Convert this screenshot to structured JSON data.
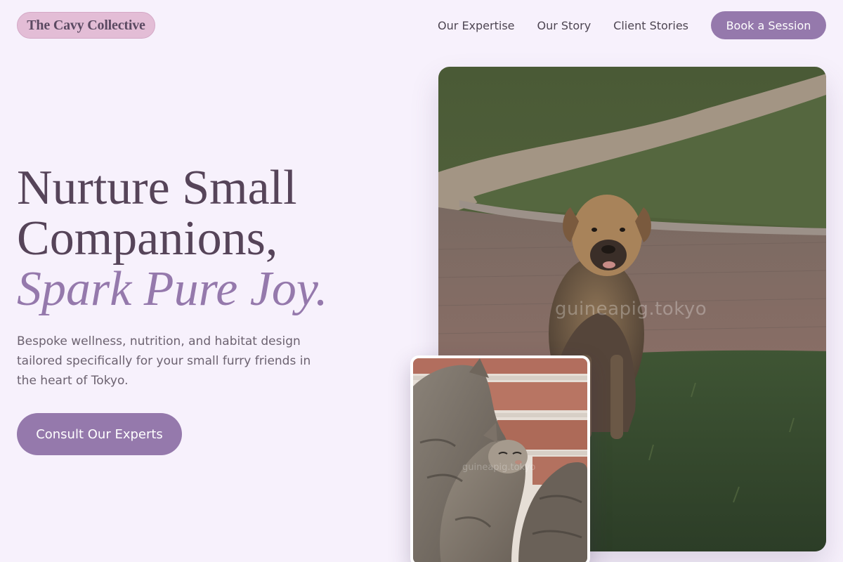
{
  "brand": {
    "name": "The Cavy Collective"
  },
  "nav": {
    "links": [
      "Our Expertise",
      "Our Story",
      "Client Stories"
    ],
    "book_label": "Book a Session"
  },
  "hero": {
    "title_line1": "Nurture Small",
    "title_line2": "Companions,",
    "title_accent": "Spark Pure Joy.",
    "subtitle": "Bespoke wellness, nutrition, and habitat design tailored specifically for your small furry friends in the heart of Tokyo.",
    "cta_label": "Consult Our Experts"
  },
  "images": {
    "main_watermark": "guineapig.tokyo",
    "small_watermark": "guineapig.tokyo"
  },
  "colors": {
    "background": "#f7f1fc",
    "accent": "#9579ac",
    "logo_bg": "#e3bdd6",
    "heading": "#564459"
  }
}
